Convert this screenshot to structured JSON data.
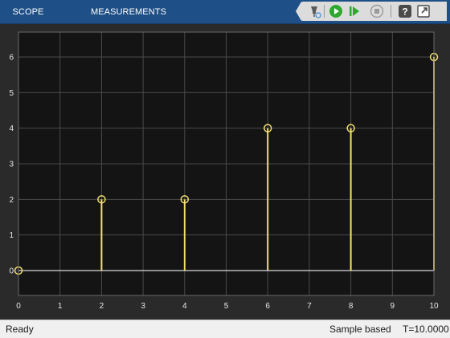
{
  "toolstrip": {
    "tabs": [
      {
        "label": "SCOPE"
      },
      {
        "label": "MEASUREMENTS"
      }
    ],
    "quick_access": [
      {
        "icon": "highlight-signal-icon"
      },
      {
        "icon": "run-icon"
      },
      {
        "icon": "step-forward-icon"
      },
      {
        "icon": "stop-icon"
      },
      {
        "icon": "help-icon"
      },
      {
        "icon": "undock-icon"
      }
    ]
  },
  "colors": {
    "toolstrip_bg": "#1e4f86",
    "plot_bg": "#141414",
    "grid": "#4a4a4a",
    "signal": "#f2df6e",
    "run_green": "#2ea82e"
  },
  "chart_data": {
    "type": "stem",
    "x": [
      0,
      2,
      4,
      6,
      8,
      10
    ],
    "y": [
      0,
      2,
      2,
      4,
      4,
      6
    ],
    "xlim": [
      0,
      10
    ],
    "ylim": [
      -0.7,
      6.7
    ],
    "xticks": [
      "0",
      "1",
      "2",
      "3",
      "4",
      "5",
      "6",
      "7",
      "8",
      "9",
      "10"
    ],
    "yticks": [
      "0",
      "1",
      "2",
      "3",
      "4",
      "5",
      "6"
    ],
    "grid": true,
    "marker": "circle"
  },
  "status": {
    "left": "Ready",
    "mode": "Sample based",
    "time": "T=10.0000"
  }
}
